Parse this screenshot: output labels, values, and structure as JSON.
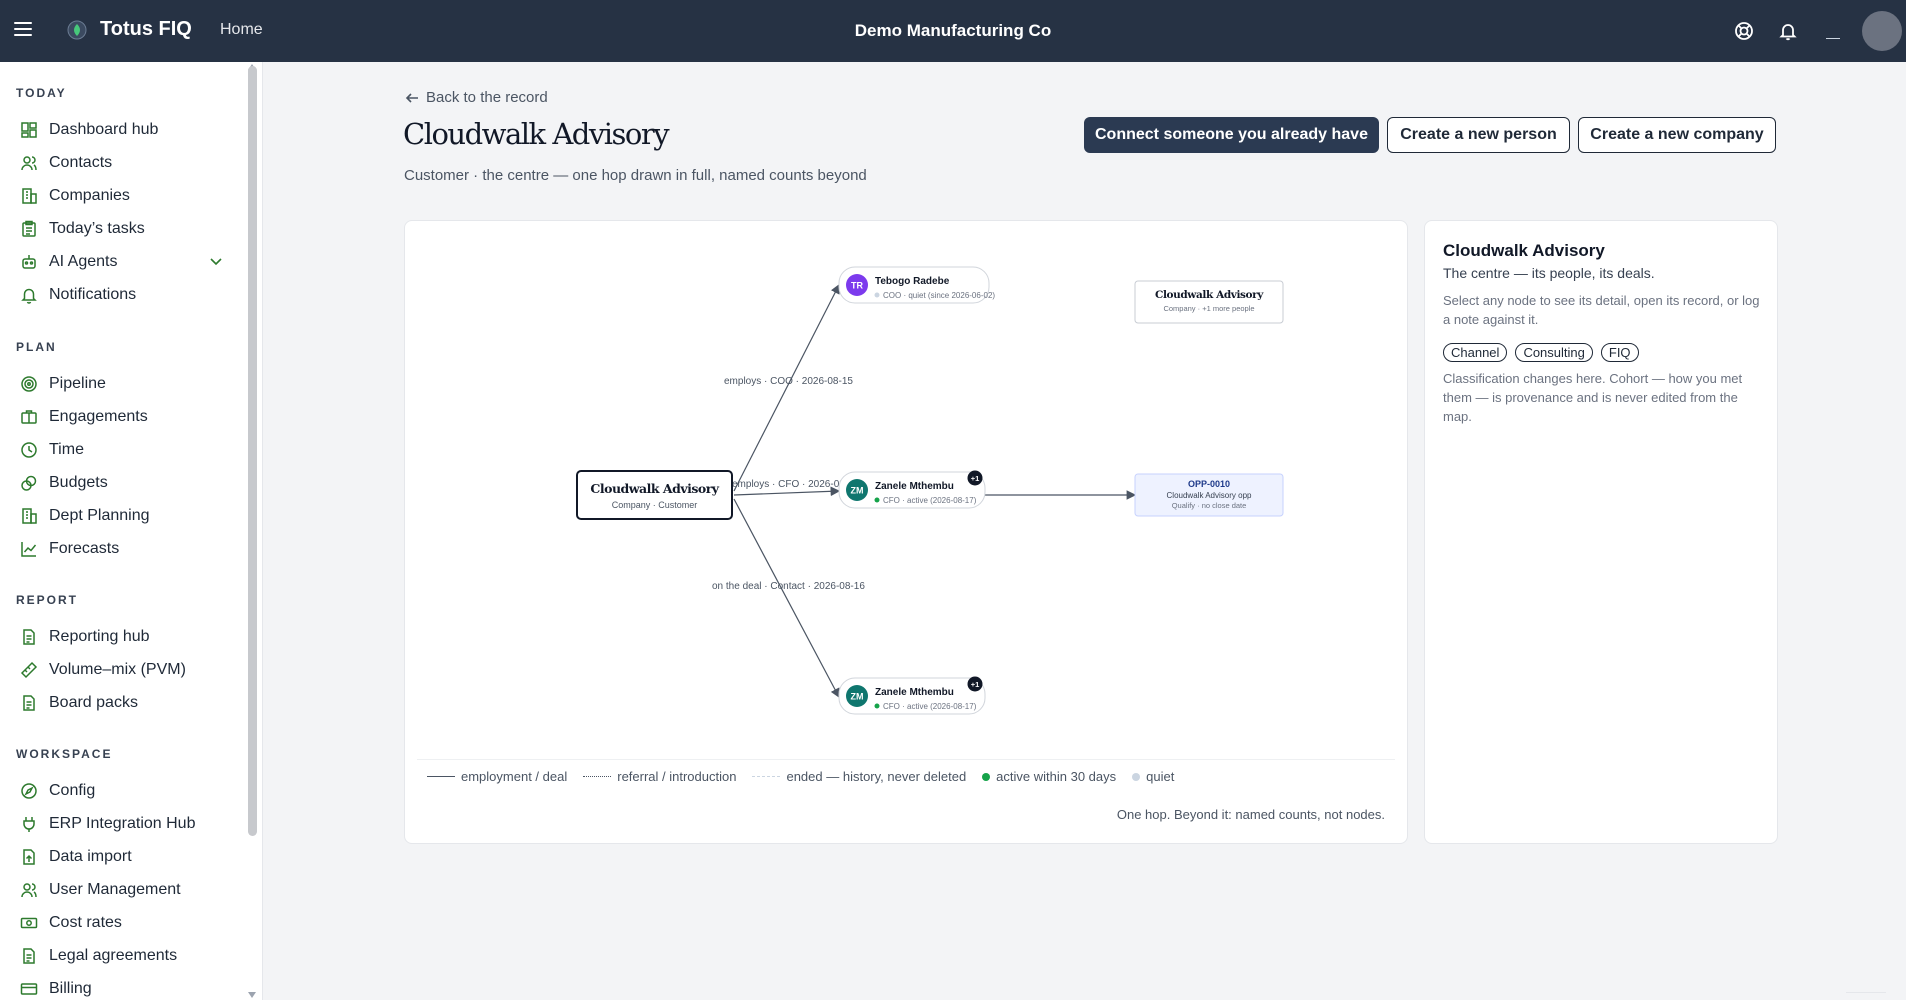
{
  "topbar": {
    "brand": "Totus FIQ",
    "home_label": "Home",
    "org_name": "Demo Manufacturing Co",
    "icons": [
      "menu-icon",
      "leaf-logo-icon",
      "help-lifebuoy-icon",
      "bell-icon",
      "avatar"
    ]
  },
  "sidebar": {
    "sections": [
      {
        "title": "TODAY",
        "items": [
          {
            "label": "Dashboard hub",
            "icon": "dashboard-icon"
          },
          {
            "label": "Contacts",
            "icon": "people-icon"
          },
          {
            "label": "Companies",
            "icon": "building-icon"
          },
          {
            "label": "Today’s tasks",
            "icon": "clipboard-icon"
          },
          {
            "label": "AI Agents",
            "icon": "robot-icon"
          },
          {
            "label": "Notifications",
            "icon": "bell-icon"
          }
        ]
      },
      {
        "title": "PLAN",
        "items": [
          {
            "label": "Pipeline",
            "icon": "target-icon"
          },
          {
            "label": "Engagements",
            "icon": "briefcase-icon"
          },
          {
            "label": "Time",
            "icon": "clock-icon"
          },
          {
            "label": "Budgets",
            "icon": "coins-icon"
          },
          {
            "label": "Dept Planning",
            "icon": "building-icon"
          },
          {
            "label": "Forecasts",
            "icon": "trend-icon"
          }
        ]
      },
      {
        "title": "REPORT",
        "items": [
          {
            "label": "Reporting hub",
            "icon": "document-icon"
          },
          {
            "label": "Volume–mix (PVM)",
            "icon": "ruler-icon"
          },
          {
            "label": "Board packs",
            "icon": "document-icon"
          }
        ]
      },
      {
        "title": "WORKSPACE",
        "items": [
          {
            "label": "Config",
            "icon": "compass-icon"
          },
          {
            "label": "ERP Integration Hub",
            "icon": "plug-icon"
          },
          {
            "label": "Data import",
            "icon": "file-upload-icon"
          },
          {
            "label": "User Management",
            "icon": "people-icon"
          },
          {
            "label": "Cost rates",
            "icon": "money-icon"
          },
          {
            "label": "Legal agreements",
            "icon": "document-icon"
          },
          {
            "label": "Billing",
            "icon": "card-icon"
          }
        ]
      }
    ]
  },
  "page": {
    "back_label": "Back to the record",
    "title": "Cloudwalk Advisory",
    "subtitle": "Customer · the centre — one hop drawn in full, named counts beyond",
    "buttons": {
      "connect": "Connect someone you already have",
      "new_person": "Create a new person",
      "new_company": "Create a new company"
    }
  },
  "map": {
    "centre": {
      "name": "Cloudwalk Advisory",
      "meta": "Company · Customer"
    },
    "nodes": [
      {
        "initials": "TR",
        "name": "Tebogo Radebe",
        "meta": "COO · quiet (since 2026-06-02)",
        "status": "quiet",
        "color": "#7c3aed",
        "badge": ""
      },
      {
        "initials": "ZM",
        "name": "Zanele Mthembu",
        "meta": "CFO · active (2026-08-17)",
        "status": "active",
        "color": "#0f766e",
        "badge": "+1"
      },
      {
        "initials": "ZM",
        "name": "Zanele Mthembu",
        "meta": "CFO · active (2026-08-17)",
        "status": "active",
        "color": "#0f766e",
        "badge": "+1"
      }
    ],
    "edges": [
      {
        "label": "employs · COO · 2026-08-15"
      },
      {
        "label": "employs · CFO · 2026-08-17"
      },
      {
        "label": "on the deal · Contact · 2026-08-16"
      }
    ],
    "company_summary": {
      "name": "Cloudwalk Advisory",
      "meta": "Company · +1 more people"
    },
    "opportunity": {
      "code": "OPP-0010",
      "name": "Cloudwalk Advisory opp",
      "meta": "Qualify · no close date"
    },
    "legend": [
      {
        "label": "employment / deal",
        "style": "solid"
      },
      {
        "label": "referral / introduction",
        "style": "dotted"
      },
      {
        "label": "ended — history, never deleted",
        "style": "dashed"
      },
      {
        "label": "active within 30 days",
        "style": "dot-active"
      },
      {
        "label": "quiet",
        "style": "dot-quiet"
      }
    ],
    "footnote": "One hop. Beyond it: named counts, not nodes."
  },
  "detail": {
    "title": "Cloudwalk Advisory",
    "subtitle": "The centre — its people, its deals.",
    "help": "Select any node to see its detail, open its record, or log a note against it.",
    "chips": [
      "Channel",
      "Consulting",
      "FIQ"
    ],
    "note": "Classification changes here. Cohort — how you met them — is provenance and is never edited from the map."
  },
  "colors": {
    "topbar": "#263244",
    "accent_green": "#2d7a2d",
    "active": "#16a34a",
    "quiet": "#cbd5e1",
    "primary_button": "#2b3a52"
  }
}
